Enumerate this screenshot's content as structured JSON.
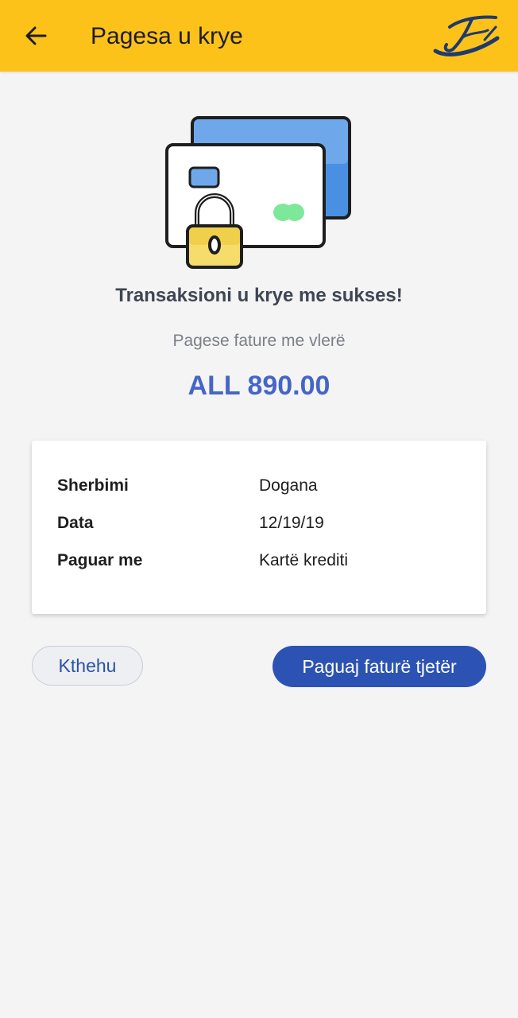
{
  "header": {
    "title": "Pagesa u krye",
    "back_icon": "arrow-left-icon",
    "logo_icon": "brand-logo-icon",
    "background_color": "#fdc21a"
  },
  "illustration_icon": "credit-cards-lock-icon",
  "status": {
    "title": "Transaksioni u krye me sukses!",
    "subtitle": "Pagese fature me vlerë",
    "amount": "ALL 890.00",
    "amount_color": "#4566c6"
  },
  "details": [
    {
      "label": "Sherbimi",
      "value": "Dogana"
    },
    {
      "label": "Data",
      "value": "12/19/19"
    },
    {
      "label": "Paguar me",
      "value": "Kartë krediti"
    }
  ],
  "actions": {
    "back_label": "Kthehu",
    "pay_again_label": "Paguaj faturë tjetër",
    "primary_color": "#2c53b4"
  }
}
